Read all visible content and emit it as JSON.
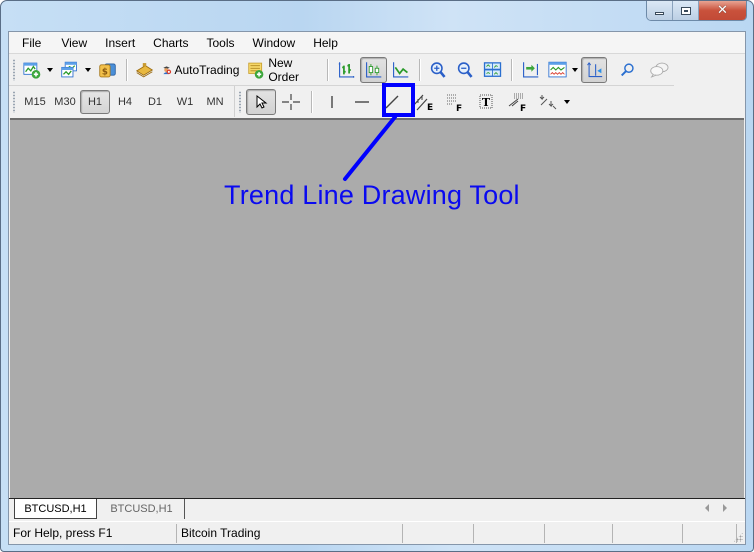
{
  "window": {
    "title": "",
    "caption_buttons": {
      "minimize": "minimize",
      "maximize": "maximize",
      "close": "close"
    }
  },
  "menu": {
    "items": [
      "File",
      "View",
      "Insert",
      "Charts",
      "Tools",
      "Window",
      "Help"
    ]
  },
  "toolbar_standard": {
    "autotrading_label": "AutoTrading",
    "new_order_label": "New Order",
    "icons": [
      "new-chart-icon",
      "profiles-icon",
      "market-watch-icon",
      "navigator-icon",
      "autotrading-icon",
      "new-order-icon",
      "bar-chart-icon",
      "candlestick-chart-icon",
      "line-chart-icon",
      "zoom-in-icon",
      "zoom-out-icon",
      "tile-windows-icon",
      "chart-shift-icon",
      "indicators-icon",
      "auto-scroll-icon",
      "search-icon",
      "chat-icon"
    ]
  },
  "timeframes": {
    "items": [
      "M15",
      "M30",
      "H1",
      "H4",
      "D1",
      "W1",
      "MN"
    ],
    "selected": "H1"
  },
  "line_studies": {
    "icons": [
      "cursor-icon",
      "crosshair-icon",
      "vertical-line-icon",
      "horizontal-line-icon",
      "trend-line-icon",
      "equidistant-channel-icon",
      "fibonacci-retracement-icon",
      "text-label-icon",
      "fibonacci-fan-icon",
      "arrows-icon"
    ],
    "selected": "cursor"
  },
  "annotation": {
    "text": "Trend Line Drawing Tool",
    "color": "#0000ff"
  },
  "chart_tabs": {
    "items": [
      "BTCUSD,H1",
      "BTCUSD,H1"
    ],
    "active_index": 0
  },
  "statusbar": {
    "help_text": "For Help, press F1",
    "profile_text": "Bitcoin Trading"
  },
  "colors": {
    "chart_background": "#ababab",
    "accent": "#0000ff"
  }
}
